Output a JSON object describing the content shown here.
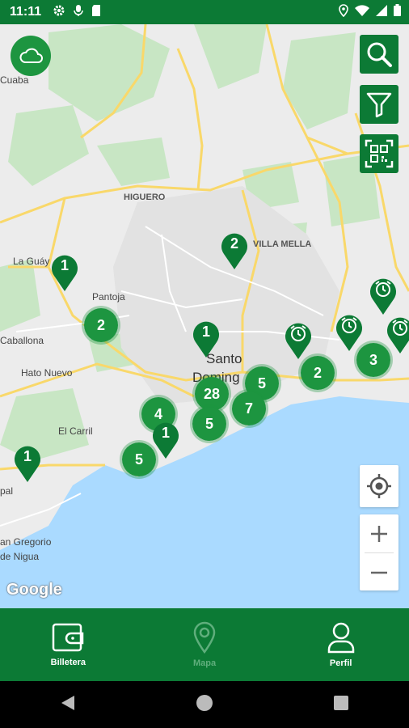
{
  "statusbar": {
    "time": "11:11"
  },
  "map": {
    "places": [
      {
        "id": "cuaba",
        "label": "Cuaba"
      },
      {
        "id": "higuero",
        "label": "HIGUERO"
      },
      {
        "id": "villa-mella",
        "label": "VILLA MELLA"
      },
      {
        "id": "la-guaya",
        "label": "La Guáy"
      },
      {
        "id": "pantoja",
        "label": "Pantoja"
      },
      {
        "id": "caballona",
        "label": "Caballona"
      },
      {
        "id": "hato-nuevo",
        "label": "Hato Nuevo"
      },
      {
        "id": "santo",
        "label": "Santo"
      },
      {
        "id": "domingo",
        "label": "Doming"
      },
      {
        "id": "el-carril",
        "label": "El Carril"
      },
      {
        "id": "pal",
        "label": "pal"
      },
      {
        "id": "san-gregorio",
        "label": "an Gregorio"
      },
      {
        "id": "de-nigua",
        "label": "de Nigua"
      }
    ],
    "clusters": [
      "2",
      "28",
      "5",
      "7",
      "5",
      "4",
      "5",
      "2",
      "3"
    ],
    "pins": [
      "1",
      "2",
      "1",
      "1",
      "1"
    ],
    "google_logo": "Google"
  },
  "nav": {
    "items": [
      {
        "label": "Billetera",
        "icon": "wallet-icon",
        "active": true
      },
      {
        "label": "Mapa",
        "icon": "map-pin-icon",
        "active": false
      },
      {
        "label": "Perfil",
        "icon": "user-icon",
        "active": true
      }
    ]
  },
  "colors": {
    "brand": "#0c7a35",
    "cluster": "#1d9540",
    "water": "#aadaff",
    "road": "#f9d86a"
  }
}
